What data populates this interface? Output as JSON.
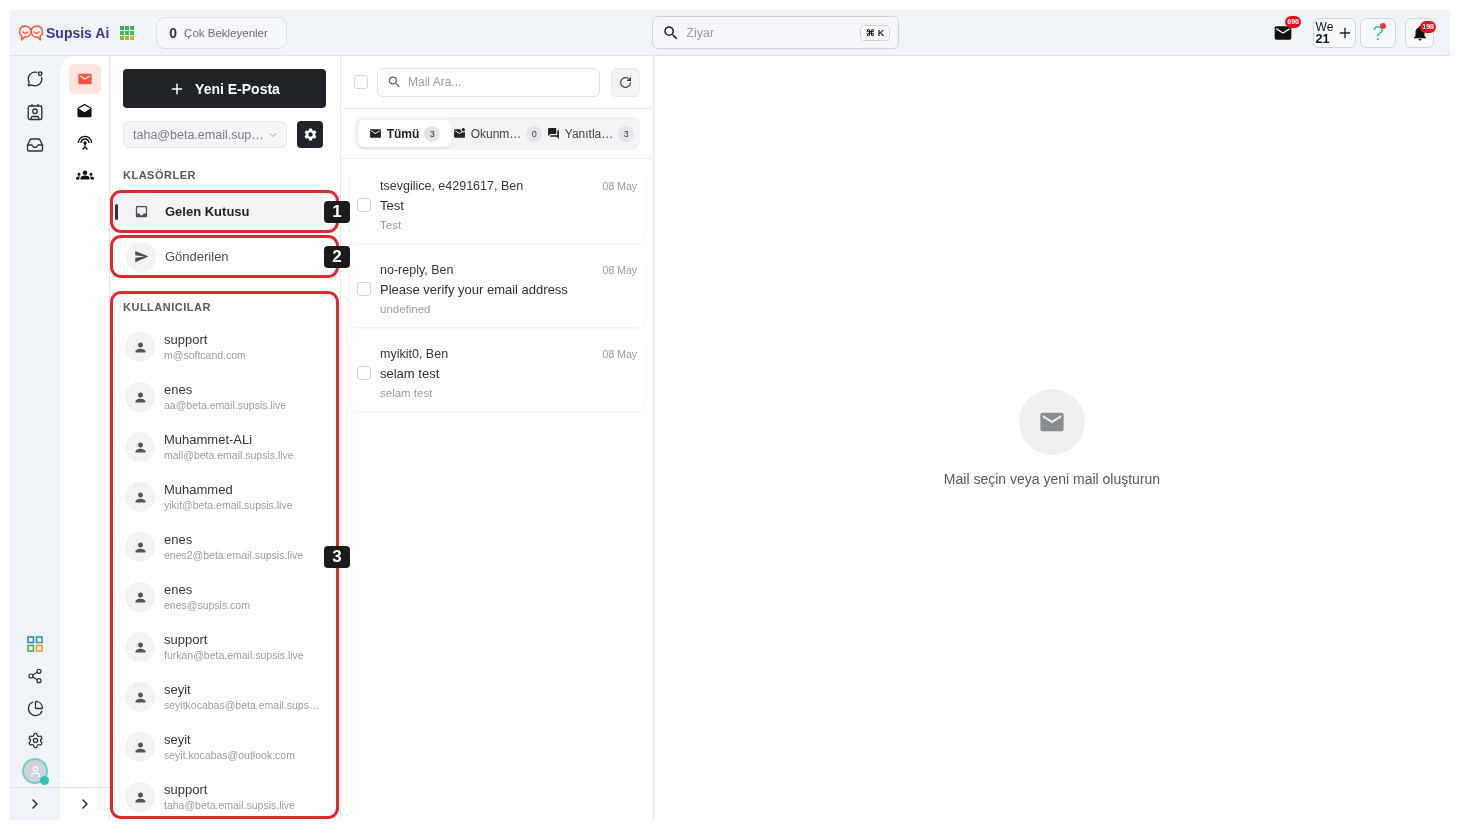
{
  "topbar": {
    "brand": "Supsis Ai",
    "pending": {
      "count": "0",
      "label": "Çok Bekleyenler"
    },
    "search": {
      "placeholder": "Ziyar",
      "shortcut": "⌘ K"
    },
    "mail_badge": "696",
    "workspace": {
      "name": "We",
      "number": "21"
    },
    "help": {
      "symbol": "?",
      "dot": true
    },
    "notifications_badge": "198"
  },
  "side_nav": {
    "user_online": true
  },
  "app_nav": [
    {
      "selected": true
    },
    {
      "selected": false
    },
    {
      "selected": false
    },
    {
      "selected": false
    }
  ],
  "folders_panel": {
    "compose_label": "Yeni E-Posta",
    "account": "taha@beta.email.sup…",
    "folders_heading": "KLASÖRLER",
    "folders": [
      {
        "label": "Gelen Kutusu",
        "selected": true,
        "callout": "1"
      },
      {
        "label": "Gönderilen",
        "selected": false,
        "callout": "2"
      }
    ],
    "users_heading": "KULLANICILAR",
    "users_callout": "3",
    "users": [
      {
        "name": "support",
        "email": "m@softcand.com"
      },
      {
        "name": "enes",
        "email": "aa@beta.email.supsis.live"
      },
      {
        "name": "Muhammet-ALi",
        "email": "mali@beta.email.supsis.live"
      },
      {
        "name": "Muhammed",
        "email": "yikit@beta.email.supsis.live"
      },
      {
        "name": "enes",
        "email": "enes2@beta.email.supsis.live"
      },
      {
        "name": "enes",
        "email": "enes@supsis.com"
      },
      {
        "name": "support",
        "email": "furkan@beta.email.supsis.live"
      },
      {
        "name": "seyit",
        "email": "seyitkocabas@beta.email.sups…"
      },
      {
        "name": "seyit",
        "email": "seyit.kocabas@outlook.com"
      },
      {
        "name": "support",
        "email": "taha@beta.email.supsis.live"
      }
    ]
  },
  "mail_list": {
    "select_all_checked": false,
    "search_placeholder": "Mail Ara...",
    "tabs": [
      {
        "label": "Tümü",
        "count": "3",
        "selected": true
      },
      {
        "label": "Okunm…",
        "count": "0",
        "selected": false
      },
      {
        "label": "Yanıtla…",
        "count": "3",
        "selected": false
      }
    ],
    "messages": [
      {
        "from": "tsevgilice, e4291617, Ben",
        "date": "08 May",
        "subject": "Test",
        "preview": "Test",
        "checked": false
      },
      {
        "from": "no-reply, Ben",
        "date": "08 May",
        "subject": "Please verify your email address",
        "preview": "undefined",
        "checked": false
      },
      {
        "from": "myikit0, Ben",
        "date": "08 May",
        "subject": "selam test",
        "preview": "selam test",
        "checked": false
      }
    ]
  },
  "empty_state": {
    "text": "Mail seçin veya yeni mail oluşturun"
  }
}
